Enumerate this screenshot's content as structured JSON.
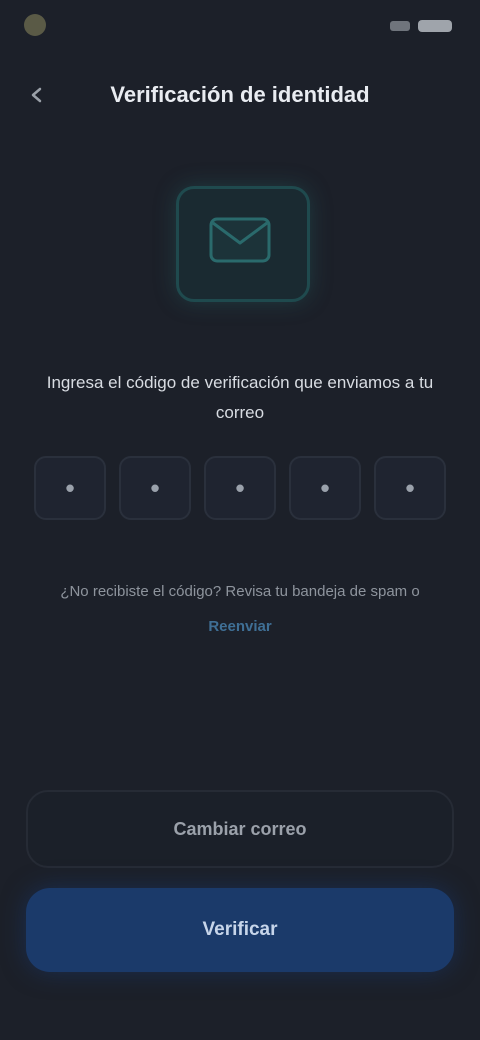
{
  "status_bar": {
    "app": "",
    "icons": [
      "signal-icon",
      "battery-icon"
    ]
  },
  "header": {
    "back_icon": "chevron-left-icon",
    "title": "Verificación de identidad"
  },
  "hero": {
    "icon": "envelope-icon",
    "accent_color": "#1f4a4e"
  },
  "instruction": {
    "text": "Ingresa el código de verificación que enviamos a tu correo"
  },
  "code": {
    "digits": [
      "•",
      "•",
      "•",
      "•",
      "•"
    ]
  },
  "resend": {
    "text": "¿No recibiste el código? Revisa tu bandeja de spam o",
    "link": "Reenviar"
  },
  "buttons": {
    "secondary": "Cambiar correo",
    "primary": "Verificar",
    "primary_color": "#1b3a6a"
  }
}
